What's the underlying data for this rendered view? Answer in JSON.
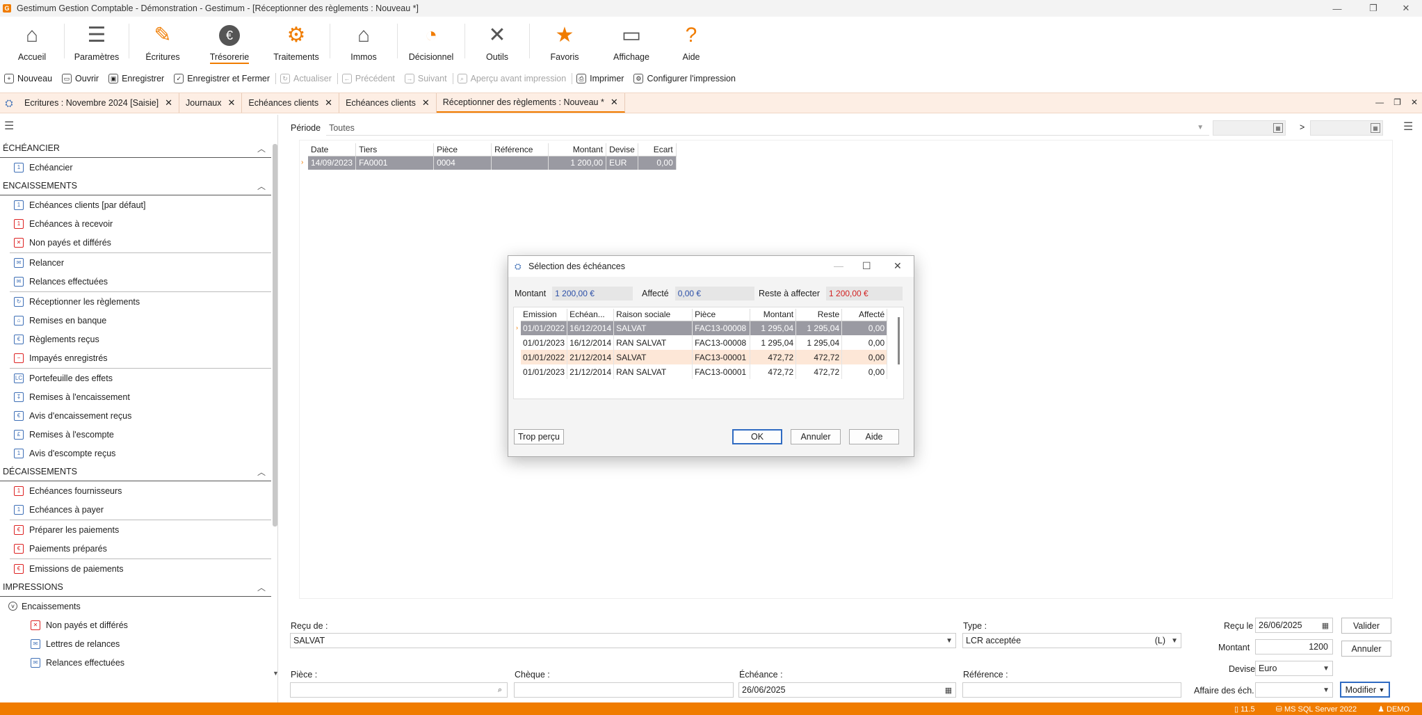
{
  "window": {
    "title": "Gestimum Gestion Comptable - Démonstration - Gestimum - [Réceptionner des règlements : Nouveau *]",
    "app_icon": "gestimum-logo-icon"
  },
  "ribbon": [
    {
      "label": "Accueil",
      "icon": "home-icon",
      "glyph": "⌂",
      "color": "#555555"
    },
    {
      "label": "Paramètres",
      "icon": "sliders-icon",
      "glyph": "☰",
      "color": "#555555"
    },
    {
      "label": "Écritures",
      "icon": "pencil-icon",
      "glyph": "✎",
      "color": "#f07c00"
    },
    {
      "label": "Trésorerie",
      "icon": "euro-icon",
      "glyph": "€",
      "color": "#555555",
      "active": true
    },
    {
      "label": "Traitements",
      "icon": "gears-icon",
      "glyph": "⚙",
      "color": "#f07c00"
    },
    {
      "label": "Immos",
      "icon": "house-euro-icon",
      "glyph": "⌂",
      "color": "#555555"
    },
    {
      "label": "Décisionnel",
      "icon": "pie-chart-icon",
      "glyph": "◔",
      "color": "#f07c00"
    },
    {
      "label": "Outils",
      "icon": "tools-icon",
      "glyph": "✕",
      "color": "#555555"
    },
    {
      "label": "Favoris",
      "icon": "star-icon",
      "glyph": "★",
      "color": "#f07c00"
    },
    {
      "label": "Affichage",
      "icon": "window-icon",
      "glyph": "▭",
      "color": "#555555"
    },
    {
      "label": "Aide",
      "icon": "question-icon",
      "glyph": "?",
      "color": "#f07c00"
    }
  ],
  "toolbar": {
    "nouveau": "Nouveau",
    "ouvrir": "Ouvrir",
    "enregistrer": "Enregistrer",
    "enregistrer_fermer": "Enregistrer et Fermer",
    "actualiser": "Actualiser",
    "precedent": "Précédent",
    "suivant": "Suivant",
    "apercu": "Aperçu avant impression",
    "imprimer": "Imprimer",
    "configurer": "Configurer l'impression"
  },
  "tabs": [
    "Ecritures : Novembre 2024 [Saisie]",
    "Journaux",
    "Echéances clients",
    "Echéances clients",
    "Réceptionner des règlements : Nouveau *"
  ],
  "sidebar": {
    "sections": {
      "echeancier": "ÉCHÉANCIER",
      "encaissements": "ENCAISSEMENTS",
      "decaissements": "DÉCAISSEMENTS",
      "impressions": "IMPRESSIONS"
    },
    "echeancier_items": [
      "Echéancier"
    ],
    "encaissements_items": [
      "Echéances clients [par défaut]",
      "Echéances à recevoir",
      "Non payés et différés",
      "Relancer",
      "Relances effectuées",
      "Réceptionner les règlements",
      "Remises en banque",
      "Règlements reçus",
      "Impayés enregistrés",
      "Portefeuille des effets",
      "Remises à l'encaissement",
      "Avis d'encaissement reçus",
      "Remises à l'escompte",
      "Avis d'escompte reçus"
    ],
    "decaissements_items": [
      "Echéances fournisseurs",
      "Echéances à payer",
      "Préparer les paiements",
      "Paiements préparés",
      "Emissions de paiements"
    ],
    "impressions_group": "Encaissements",
    "impressions_items": [
      "Non payés et différés",
      "Lettres de relances",
      "Relances effectuées"
    ]
  },
  "periode": {
    "label": "Période",
    "value": "Toutes",
    "separator": ">"
  },
  "main_grid": {
    "headers": [
      "Date",
      "Tiers",
      "Pièce",
      "Référence",
      "Montant",
      "Devise",
      "Ecart"
    ],
    "rows": [
      [
        "14/09/2023",
        "FA0001",
        "0004",
        "",
        "1 200,00",
        "EUR",
        "0,00"
      ]
    ]
  },
  "form": {
    "recu_de_label": "Reçu de :",
    "recu_de_value": "SALVAT",
    "type_label": "Type :",
    "type_value": "LCR acceptée",
    "type_code": "(L)",
    "recu_le_label": "Reçu le",
    "recu_le_value": "26/06/2025",
    "montant_label": "Montant",
    "montant_value": "1200",
    "devise_label": "Devise",
    "devise_value": "Euro",
    "piece_label": "Pièce :",
    "cheque_label": "Chèque :",
    "echeance_label": "Échéance :",
    "echeance_value": "26/06/2025",
    "reference_label": "Référence :",
    "affaire_label": "Affaire des éch.",
    "valider": "Valider",
    "annuler": "Annuler",
    "modifier": "Modifier"
  },
  "dialog": {
    "title": "Sélection des échéances",
    "montant_label": "Montant",
    "montant_value": "1 200,00 €",
    "affecte_label": "Affecté",
    "affecte_value": "0,00 €",
    "reste_label": "Reste à affecter",
    "reste_value": "1 200,00 €",
    "headers": [
      "Emission",
      "Echéan...",
      "Raison sociale",
      "Pièce",
      "Montant",
      "Reste",
      "Affecté"
    ],
    "rows": [
      [
        "01/01/2022",
        "16/12/2014",
        "SALVAT",
        "FAC13-00008",
        "1 295,04",
        "1 295,04",
        "0,00"
      ],
      [
        "01/01/2023",
        "16/12/2014",
        "RAN SALVAT",
        "FAC13-00008",
        "1 295,04",
        "1 295,04",
        "0,00"
      ],
      [
        "01/01/2022",
        "21/12/2014",
        "SALVAT",
        "FAC13-00001",
        "472,72",
        "472,72",
        "0,00"
      ],
      [
        "01/01/2023",
        "21/12/2014",
        "RAN SALVAT",
        "FAC13-00001",
        "472,72",
        "472,72",
        "0,00"
      ]
    ],
    "trop_percu": "Trop perçu",
    "ok": "OK",
    "annuler": "Annuler",
    "aide": "Aide"
  },
  "status": {
    "version": "11.5",
    "server": "MS SQL Server 2022",
    "user": "DEMO"
  },
  "colors": {
    "accent": "#f07c00",
    "tabs_bg": "#fdeee4",
    "selected_row": "#9a9aa2",
    "reste_red": "#d22222",
    "value_blue": "#2b4fa8"
  }
}
